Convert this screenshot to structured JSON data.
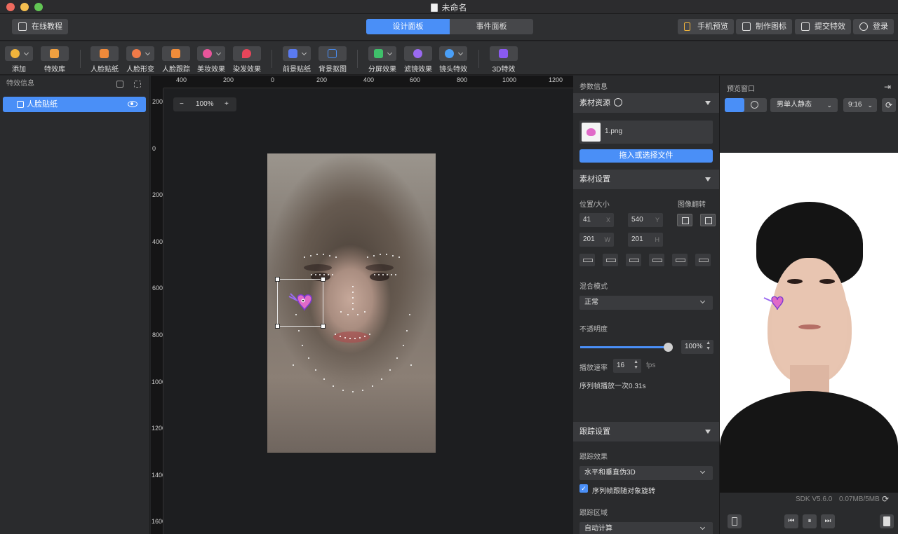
{
  "window": {
    "title": "未命名"
  },
  "header": {
    "tutorial": "在线教程",
    "tabs": [
      "设计面板",
      "事件面板"
    ],
    "actions": [
      "手机预览",
      "制作图标",
      "提交特效",
      "登录"
    ]
  },
  "toolbar": {
    "items": [
      {
        "label": "添加",
        "icon": "plus-icon",
        "color": "#f0b43c"
      },
      {
        "label": "特效库",
        "icon": "library-icon",
        "color": "#f0a040"
      },
      {
        "label": "人脸贴纸",
        "icon": "face-sticker-icon",
        "color": "#f08a3a"
      },
      {
        "label": "人脸形变",
        "icon": "face-morph-icon",
        "color": "#f07a48"
      },
      {
        "label": "人脸跟踪",
        "icon": "face-track-icon",
        "color": "#f08c3a"
      },
      {
        "label": "美妆效果",
        "icon": "makeup-icon",
        "color": "#e8559a"
      },
      {
        "label": "染发效果",
        "icon": "hair-dye-icon",
        "color": "#e8455a"
      },
      {
        "label": "前景贴纸",
        "icon": "foreground-sticker-icon",
        "color": "#5a7af0"
      },
      {
        "label": "背景抠图",
        "icon": "background-cutout-icon",
        "color": "#4a8ff7"
      },
      {
        "label": "分屏效果",
        "icon": "split-screen-icon",
        "color": "#3fbf6a"
      },
      {
        "label": "滤镜效果",
        "icon": "filter-icon",
        "color": "#9a6af0"
      },
      {
        "label": "镜头特效",
        "icon": "lens-effect-icon",
        "color": "#4a9ff7"
      },
      {
        "label": "3D特效",
        "icon": "3d-effect-icon",
        "color": "#8a5af0"
      }
    ]
  },
  "left": {
    "title": "特效信息",
    "layer": "人脸贴纸"
  },
  "canvas": {
    "zoom": "100%",
    "zoom_minus": "−",
    "zoom_plus": "+",
    "ruler_top": [
      "400",
      "200",
      "0",
      "200",
      "400",
      "600",
      "800",
      "1000",
      "1200"
    ],
    "ruler_left": [
      "200",
      "0",
      "200",
      "400",
      "600",
      "800",
      "1000",
      "1200",
      "1400",
      "1600"
    ]
  },
  "params": {
    "title": "参数信息",
    "material": {
      "title": "素材资源",
      "file": "1.png",
      "upload": "拖入或选择文件"
    },
    "settings": {
      "title": "素材设置",
      "pos_size": "位置/大小",
      "flip": "图像翻转",
      "x": "41",
      "y": "540",
      "w": "201",
      "h": "201",
      "x_sfx": "X",
      "y_sfx": "Y",
      "w_sfx": "W",
      "h_sfx": "H",
      "blend_label": "混合模式",
      "blend": "正常",
      "opacity_label": "不透明度",
      "opacity": "100%",
      "opacity_value": 1.0,
      "rate_label": "播放速率",
      "rate": "16",
      "rate_unit": "fps",
      "loop_note": "序列帧播放一次0.31s"
    },
    "tracking": {
      "title": "跟踪设置",
      "effect_label": "跟踪效果",
      "effect": "水平和垂直伪3D",
      "rotate_label": "序列帧跟随对象旋转",
      "rotate_checked": true,
      "area_label": "跟踪区域",
      "area": "自动计算"
    }
  },
  "preview": {
    "title": "预览窗口",
    "model": "男单人静态",
    "ratio": "9:16",
    "sdk": "SDK V5.6.0",
    "size": "0.07MB/5MB"
  }
}
